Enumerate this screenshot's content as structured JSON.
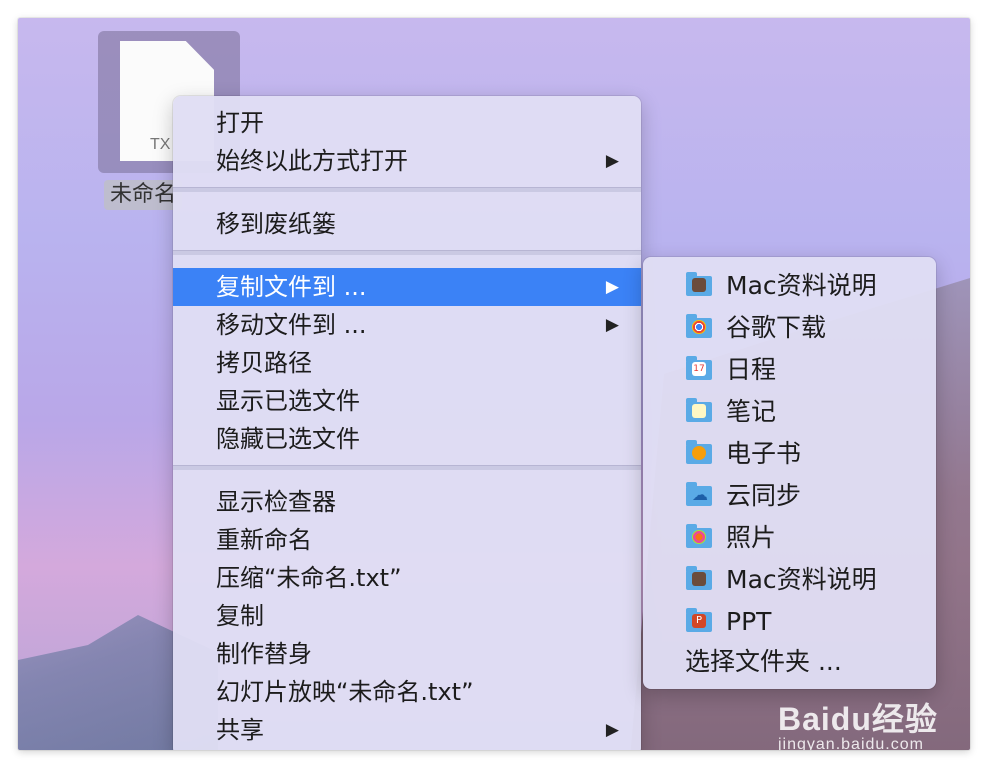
{
  "desktop": {
    "file": {
      "extension_label": "TX",
      "name_label": "未命名"
    }
  },
  "context_menu": {
    "groups": [
      [
        {
          "label": "打开",
          "has_submenu": false
        },
        {
          "label": "始终以此方式打开",
          "has_submenu": true
        }
      ],
      [
        {
          "label": "移到废纸篓",
          "has_submenu": false
        }
      ],
      [
        {
          "label": "复制文件到 ...",
          "has_submenu": true,
          "active": true
        },
        {
          "label": "移动文件到 ...",
          "has_submenu": true
        },
        {
          "label": "拷贝路径",
          "has_submenu": false
        },
        {
          "label": "显示已选文件",
          "has_submenu": false
        },
        {
          "label": "隐藏已选文件",
          "has_submenu": false
        }
      ],
      [
        {
          "label": "显示检查器",
          "has_submenu": false
        },
        {
          "label": "重新命名",
          "has_submenu": false
        },
        {
          "label": "压缩“未命名.txt”",
          "has_submenu": false
        },
        {
          "label": "复制",
          "has_submenu": false
        },
        {
          "label": "制作替身",
          "has_submenu": false
        },
        {
          "label": "幻灯片放映“未命名.txt”",
          "has_submenu": false
        },
        {
          "label": "共享",
          "has_submenu": true
        }
      ]
    ],
    "submenu_arrow": "▶"
  },
  "submenu": {
    "items": [
      {
        "label": "Mac资料说明",
        "icon": "mac-folder-icon"
      },
      {
        "label": "谷歌下载",
        "icon": "chrome-folder-icon"
      },
      {
        "label": "日程",
        "icon": "calendar-folder-icon"
      },
      {
        "label": "笔记",
        "icon": "notes-folder-icon"
      },
      {
        "label": "电子书",
        "icon": "books-folder-icon"
      },
      {
        "label": "云同步",
        "icon": "cloud-folder-icon"
      },
      {
        "label": "照片",
        "icon": "photos-folder-icon"
      },
      {
        "label": "Mac资料说明",
        "icon": "mac-folder-icon"
      },
      {
        "label": "PPT",
        "icon": "ppt-folder-icon"
      }
    ],
    "choose_label": "选择文件夹 ..."
  },
  "watermark": {
    "logo": "Baidu经验",
    "url": "jingyan.baidu.com"
  },
  "colors": {
    "highlight": "#3b82f6",
    "folder": "#5aaae6"
  }
}
